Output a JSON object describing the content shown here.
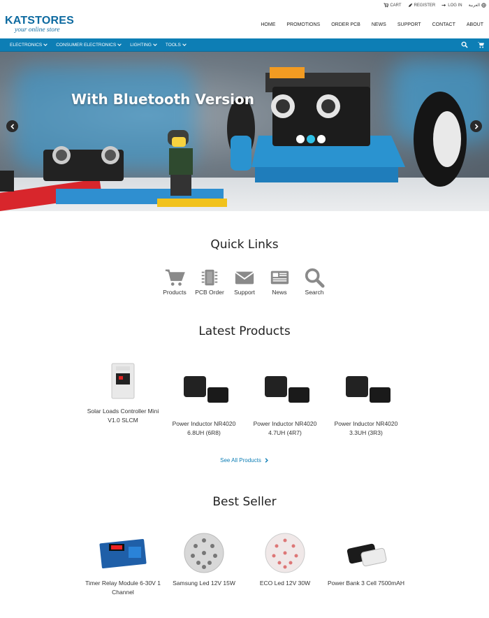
{
  "topbar": {
    "cart": "CART",
    "register": "REGISTER",
    "login": "LOG IN",
    "language": "العربية"
  },
  "header": {
    "logo_name": "KATSTORES",
    "logo_tagline": "your online store",
    "nav": [
      "HOME",
      "PROMOTIONS",
      "ORDER PCB",
      "NEWS",
      "SUPPORT",
      "CONTACT",
      "ABOUT"
    ]
  },
  "categories": [
    "ELECTRONICS",
    "CONSUMER ELECTRONICS",
    "LIGHTING",
    "TOOLS"
  ],
  "hero": {
    "title": "With Bluetooth Version"
  },
  "quick_links": {
    "title": "Quick Links",
    "items": [
      {
        "label": "Products",
        "icon": "cart-icon"
      },
      {
        "label": "PCB Order",
        "icon": "chip-icon"
      },
      {
        "label": "Support",
        "icon": "envelope-icon"
      },
      {
        "label": "News",
        "icon": "newspaper-icon"
      },
      {
        "label": "Search",
        "icon": "search-icon"
      }
    ]
  },
  "latest_products": {
    "title": "Latest Products",
    "items": [
      {
        "name": "Solar Loads Controller Mini V1.0 SLCM"
      },
      {
        "name": "Power Inductor NR4020 6.8UH (6R8)"
      },
      {
        "name": "Power Inductor NR4020 4.7UH (4R7)"
      },
      {
        "name": "Power Inductor NR4020 3.3UH (3R3)"
      }
    ],
    "see_all": "See All Products"
  },
  "best_seller": {
    "title": "Best Seller",
    "items": [
      {
        "name": "Timer Relay Module 6-30V 1 Channel"
      },
      {
        "name": "Samsung Led 12V 15W"
      },
      {
        "name": "ECO Led 12V 30W"
      },
      {
        "name": "Power Bank 3 Cell 7500mAH"
      }
    ]
  },
  "colors": {
    "brand_blue": "#0d6aa0",
    "category_bar": "#0d7eb5",
    "icon_gray": "#8a8a8a"
  }
}
